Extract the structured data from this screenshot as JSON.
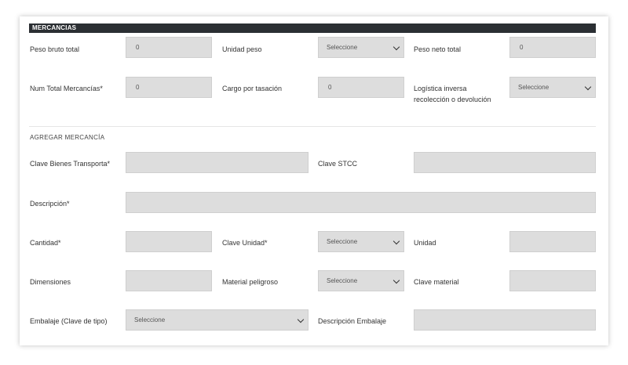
{
  "section": {
    "title": "MERCANCIAS"
  },
  "row1": {
    "peso_bruto_label": "Peso bruto total",
    "peso_bruto_value": "0",
    "unidad_peso_label": "Unidad peso",
    "unidad_peso_value": "Seleccione",
    "peso_neto_label": "Peso neto total",
    "peso_neto_value": "0"
  },
  "row2": {
    "num_total_label": "Num Total Mercancías*",
    "num_total_value": "0",
    "cargo_label": "Cargo por tasación",
    "cargo_value": "0",
    "logistica_label_line1": "Logística inversa",
    "logistica_label_line2": "recolección o devolución",
    "logistica_value": "Seleccione"
  },
  "agregar": {
    "title": "AGREGAR MERCANCÍA",
    "clave_bienes_label": "Clave Bienes Transporta*",
    "clave_bienes_value": "",
    "clave_stcc_label": "Clave STCC",
    "clave_stcc_value": "",
    "descripcion_label": "Descripción*",
    "descripcion_value": "",
    "cantidad_label": "Cantidad*",
    "cantidad_value": "",
    "clave_unidad_label": "Clave Unidad*",
    "clave_unidad_value": "Seleccione",
    "unidad_label": "Unidad",
    "unidad_value": "",
    "dimensiones_label": "Dimensiones",
    "dimensiones_value": "",
    "material_label": "Material peligroso",
    "material_value": "Seleccione",
    "clave_material_label": "Clave material",
    "clave_material_value": "",
    "embalaje_label": "Embalaje (Clave de tipo)",
    "embalaje_value": "Seleccione",
    "desc_embalaje_label": "Descripción Embalaje",
    "desc_embalaje_value": ""
  }
}
